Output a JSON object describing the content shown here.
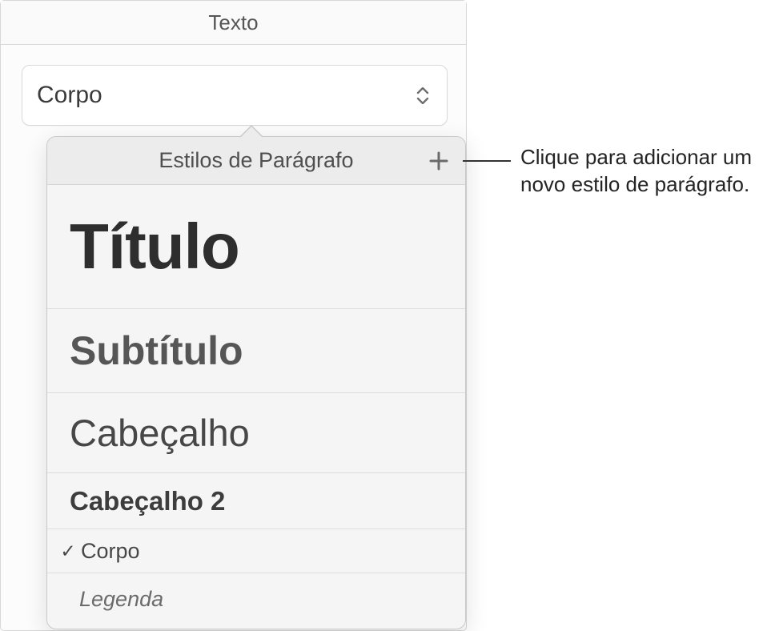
{
  "panel": {
    "header": "Texto"
  },
  "select": {
    "current": "Corpo"
  },
  "popover": {
    "title": "Estilos de Parágrafo",
    "styles": {
      "titulo": "Título",
      "subtitulo": "Subtítulo",
      "cabecalho": "Cabeçalho",
      "cabecalho2": "Cabeçalho 2",
      "corpo": "Corpo",
      "legenda": "Legenda"
    },
    "checkmark": "✓"
  },
  "callout": {
    "text": "Clique para adicionar um novo estilo de parágrafo."
  }
}
